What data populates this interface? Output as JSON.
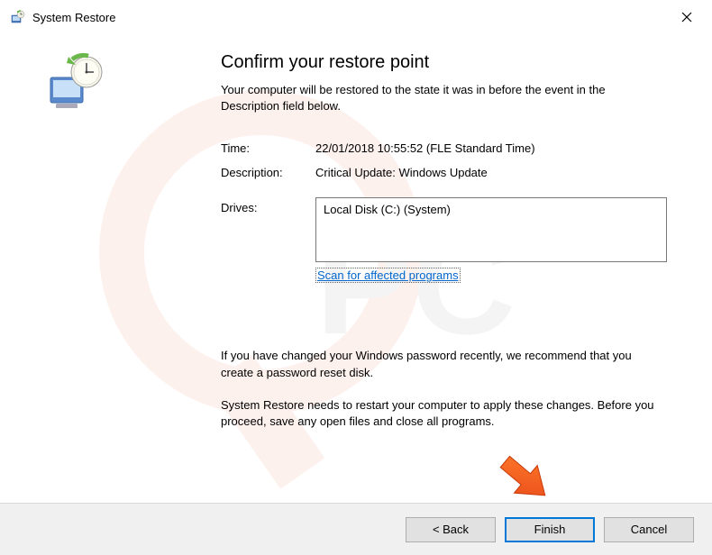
{
  "titlebar": {
    "title": "System Restore"
  },
  "main": {
    "heading": "Confirm your restore point",
    "subtext": "Your computer will be restored to the state it was in before the event in the Description field below.",
    "time_label": "Time:",
    "time_value": "22/01/2018 10:55:52 (FLE Standard Time)",
    "description_label": "Description:",
    "description_value": "Critical Update: Windows Update",
    "drives_label": "Drives:",
    "drives_value": "Local Disk (C:) (System)",
    "scan_link": "Scan for affected programs",
    "warning1": "If you have changed your Windows password recently, we recommend that you create a password reset disk.",
    "warning2": "System Restore needs to restart your computer to apply these changes. Before you proceed, save any open files and close all programs."
  },
  "buttons": {
    "back": "< Back",
    "finish": "Finish",
    "cancel": "Cancel"
  }
}
